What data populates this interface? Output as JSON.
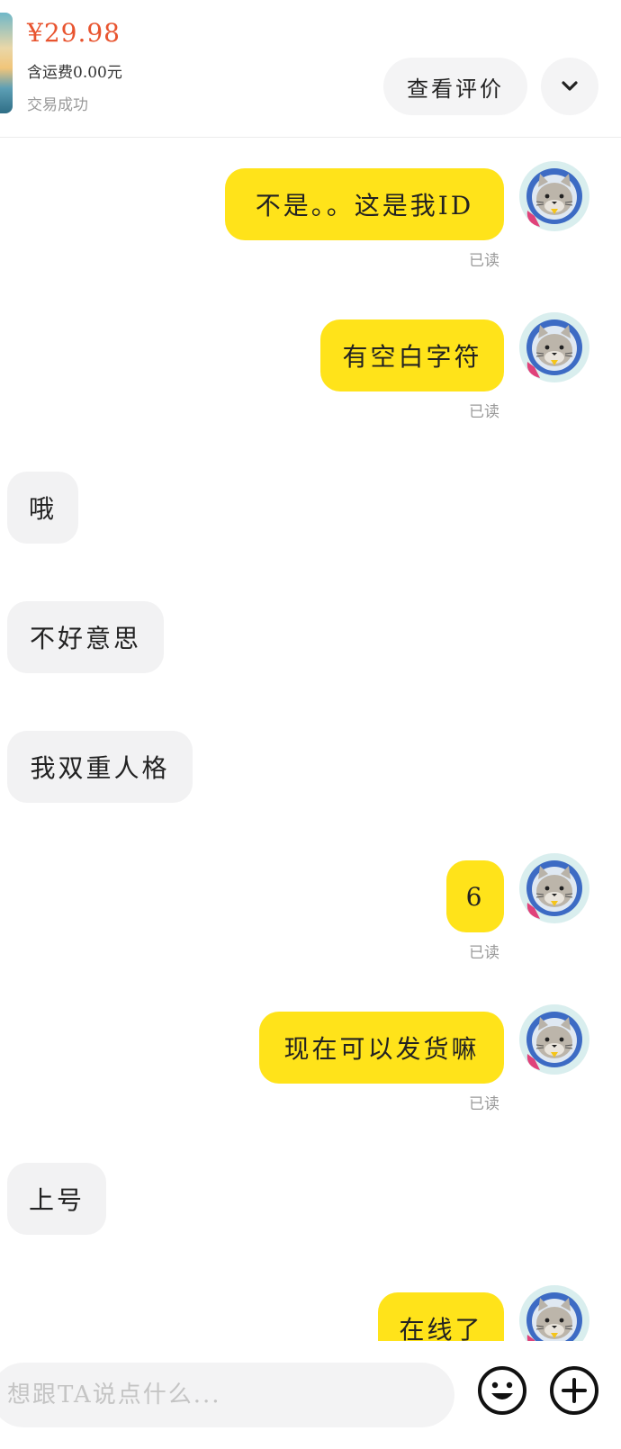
{
  "order": {
    "price": "¥29.98",
    "shipping": "含运费0.00元",
    "status": "交易成功",
    "review_button": "查看评价"
  },
  "messages": [
    {
      "from": "me",
      "text": "不是。。这是我ID",
      "receipt": "已读"
    },
    {
      "from": "me",
      "text": "有空白字符",
      "receipt": "已读"
    },
    {
      "from": "them",
      "text": "哦"
    },
    {
      "from": "them",
      "text": "不好意思"
    },
    {
      "from": "them",
      "text": "我双重人格"
    },
    {
      "from": "me",
      "text": "6",
      "receipt": "已读"
    },
    {
      "from": "me",
      "text": "现在可以发货嘛",
      "receipt": "已读"
    },
    {
      "from": "them",
      "text": "上号"
    },
    {
      "from": "me",
      "text": "在线了"
    }
  ],
  "input": {
    "placeholder": "想跟TA说点什么..."
  },
  "icons": {
    "expand": "chevron-down-icon",
    "emoji": "emoji-icon",
    "add": "plus-circle-icon",
    "avatar": "cat-astronaut-avatar"
  },
  "colors": {
    "price": "#e8542f",
    "my_bubble": "#ffe31a",
    "their_bubble": "#f2f2f3"
  }
}
